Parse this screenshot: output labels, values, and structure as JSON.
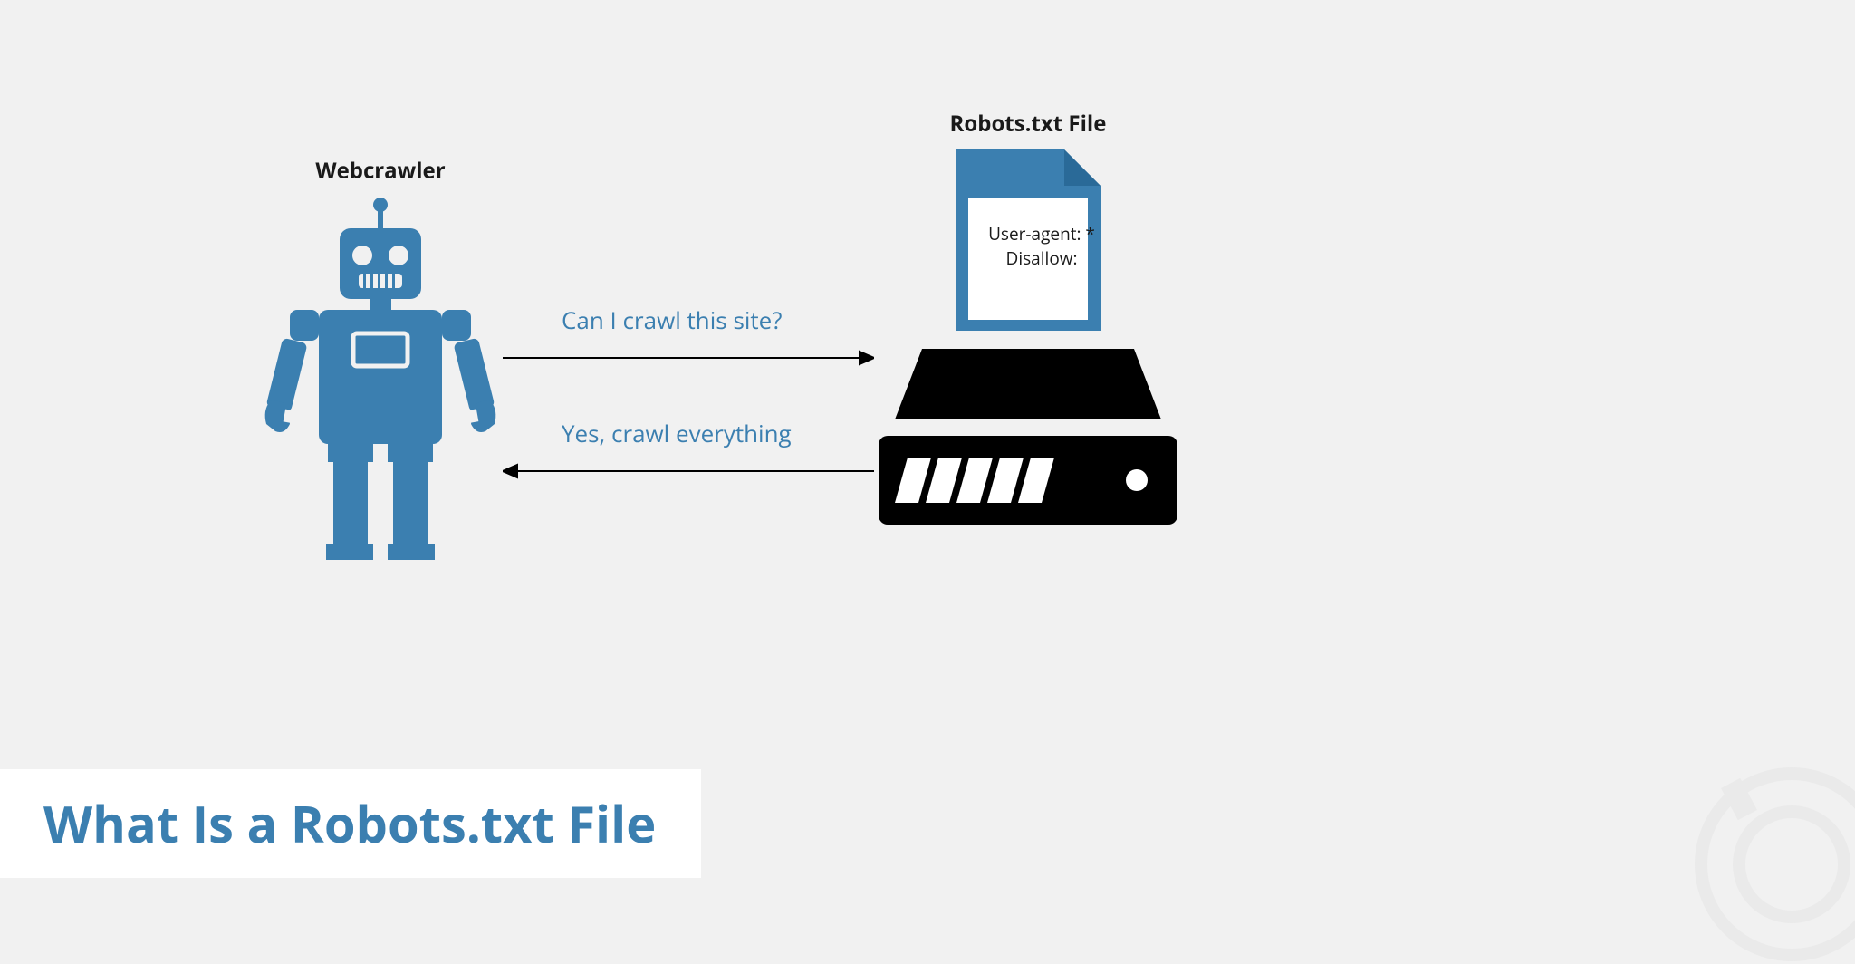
{
  "labels": {
    "webcrawler": "Webcrawler",
    "robotsFile": "Robots.txt File"
  },
  "arrows": {
    "request": "Can I crawl this site?",
    "response": "Yes, crawl everything"
  },
  "fileContent": {
    "line1": "User-agent: *",
    "line2": "Disallow:"
  },
  "title": "What Is a Robots.txt File",
  "colors": {
    "blue": "#3b7fb0",
    "black": "#000000",
    "background": "#f1f1f1"
  }
}
